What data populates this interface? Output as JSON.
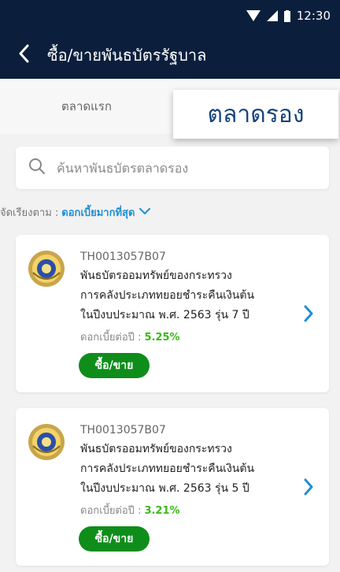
{
  "status": {
    "time": "12:30"
  },
  "header": {
    "title": "ซื้อ/ขายพันธบัตรรัฐบาล"
  },
  "tabs": [
    {
      "label": "ตลาดแรก",
      "selected": false
    },
    {
      "label": "ตลาดรอง",
      "selected": true
    }
  ],
  "search": {
    "placeholder": "ค้นหาพันธบัตรตลาดรอง",
    "value": ""
  },
  "sort": {
    "label": "จัดเรียงตาม :",
    "value": "ดอกเบี้ยมากที่สุด"
  },
  "bonds": [
    {
      "code": "TH0013057B07",
      "name_lines": [
        "พันธบัตรออมทรัพย์ของกระทรวง",
        "การคลังประเภททยอยชำระคืนเงินต้น",
        "ในปีงบประมาณ พ.ศ. 2563 รุ่น 7 ปี"
      ],
      "rate_label": "ดอกเบี้ยต่อปี :",
      "rate": "5.25%",
      "button": "ซื้อ/ขาย"
    },
    {
      "code": "TH0013057B07",
      "name_lines": [
        "พันธบัตรออมทรัพย์ของกระทรวง",
        "การคลังประเภททยอยชำระคืนเงินต้น",
        "ในปีงบประมาณ พ.ศ. 2563 รุ่น 5 ปี"
      ],
      "rate_label": "ดอกเบี้ยต่อปี :",
      "rate": "3.21%",
      "button": "ซื้อ/ขาย"
    }
  ],
  "colors": {
    "header_bg": "#0b1f3d",
    "tab_active_text": "#17447c",
    "sort_accent": "#1f8fd6",
    "rate_green": "#3cb81a",
    "button_green": "#0f8d1b",
    "chevron_blue": "#1f8fd6"
  }
}
